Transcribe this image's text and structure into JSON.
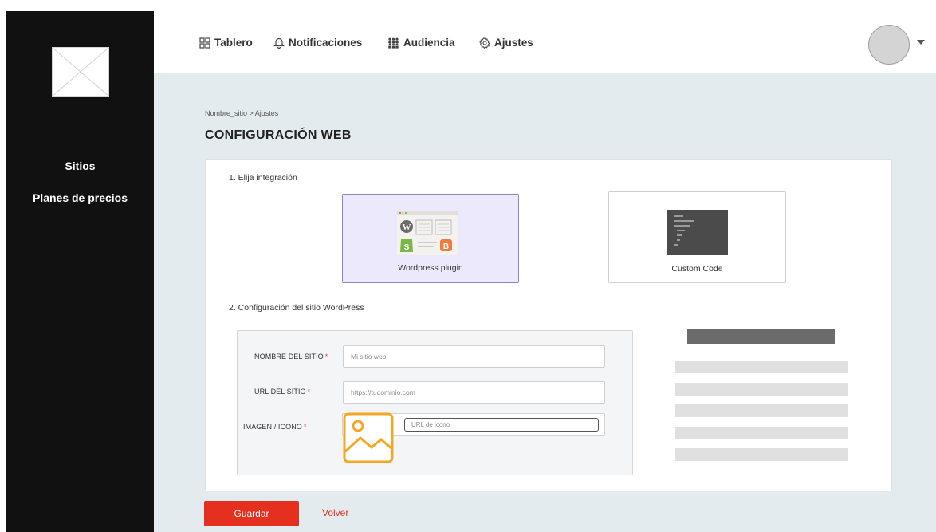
{
  "sidebar": {
    "logo_icon": "image-placeholder-icon",
    "items": [
      {
        "label": "Sitios"
      },
      {
        "label": "Planes de precios"
      }
    ]
  },
  "topnav": {
    "items": [
      {
        "label": "Tablero",
        "icon": "dashboard-icon"
      },
      {
        "label": "Notificaciones",
        "icon": "bell-icon"
      },
      {
        "label": "Audiencia",
        "icon": "audience-icon"
      },
      {
        "label": "Ajustes",
        "icon": "gear-icon"
      }
    ],
    "avatar_icon": "avatar",
    "avatar_caret_icon": "caret-down-icon"
  },
  "main": {
    "breadcrumb": "Nombre_sitio > Ajustes",
    "title": "CONFIGURACIÓN WEB",
    "step1_label": "1. Elija integración",
    "options": [
      {
        "label": "Wordpress plugin",
        "icon": "cms-plugins-icon",
        "selected": true
      },
      {
        "label": "Custom Code",
        "icon": "code-editor-icon",
        "selected": false
      }
    ],
    "step2_label": "2. Configuración del sitio WordPress",
    "form": {
      "site_name_label": "NOMBRE DEL SITIO",
      "site_name_placeholder": "Mi sitio web",
      "site_url_label": "URL DEL SITIO",
      "site_url_placeholder": "https://tudominio.com",
      "image_label": "IMAGEN / ICONO",
      "icon_url_placeholder": "URL de icono",
      "required_mark": "*"
    }
  },
  "actions": {
    "save_label": "Guardar",
    "back_label": "Volver"
  },
  "colors": {
    "sidebar_bg": "#111111",
    "content_bg": "#e3ebee",
    "accent_red": "#e6301f",
    "selected_option_bg": "#ebe9fb",
    "image_icon_orange": "#f5a623"
  }
}
